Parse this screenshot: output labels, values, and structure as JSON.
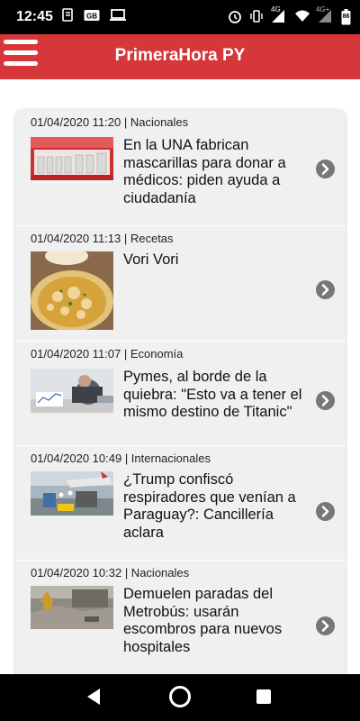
{
  "status_bar": {
    "time": "12:45",
    "battery": "86",
    "network_4g": "4G",
    "network_4g_plus": "4G+"
  },
  "app_bar": {
    "title": "PrimeraHora PY",
    "menu_icon": "hamburger-menu-icon",
    "color": "#d5373a"
  },
  "articles": [
    {
      "meta": "01/04/2020 11:20 | Nacionales",
      "headline": "En la UNA fabrican mascarillas para donar a médicos: piden ayuda a ciudadanía",
      "image": "masks-lab-photo"
    },
    {
      "meta": "01/04/2020 11:13 | Recetas",
      "headline": "Vori Vori",
      "image": "vori-vori-soup-photo"
    },
    {
      "meta": "01/04/2020 11:07 | Economía",
      "headline": "Pymes, al borde de la quiebra: \"Esto va a tener el mismo destino de Titanic\"",
      "image": "worried-businessman-photo"
    },
    {
      "meta": "01/04/2020 10:49 | Internacionales",
      "headline": "¿Trump confiscó respiradores que venían a Paraguay?: Cancillería aclara",
      "image": "airport-cargo-photo"
    },
    {
      "meta": "01/04/2020 10:32 | Nacionales",
      "headline": "Demuelen paradas del Metrobús: usarán escombros para nuevos hospitales",
      "image": "demolition-photo"
    }
  ],
  "nav": {
    "back_icon": "back-triangle-icon",
    "home_icon": "home-circle-icon",
    "recents_icon": "recents-square-icon"
  }
}
